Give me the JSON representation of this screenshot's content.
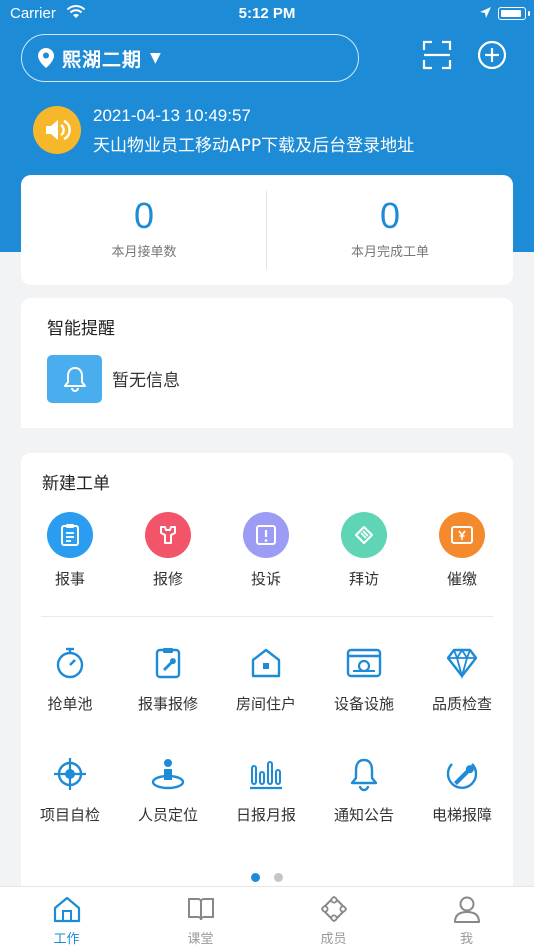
{
  "status_bar": {
    "carrier": "Carrier",
    "time": "5:12 PM"
  },
  "header": {
    "project_name": "熙湖二期",
    "arrow": "▼"
  },
  "notice": {
    "time": "2021-04-13 10:49:57",
    "text": "天山物业员工移动APP下载及后台登录地址"
  },
  "stats": [
    {
      "value": "0",
      "label": "本月接单数"
    },
    {
      "value": "0",
      "label": "本月完成工单"
    }
  ],
  "reminder": {
    "title": "智能提醒",
    "empty_text": "暂无信息"
  },
  "new_order": {
    "title": "新建工单",
    "primary": [
      {
        "label": "报事",
        "icon": "clipboard-icon",
        "color": "#2b9df0"
      },
      {
        "label": "报修",
        "icon": "wrench-icon",
        "color": "#f2546a"
      },
      {
        "label": "投诉",
        "icon": "complaint-icon",
        "color": "#9d9cf5"
      },
      {
        "label": "拜访",
        "icon": "visit-icon",
        "color": "#5fd5b6"
      },
      {
        "label": "催缴",
        "icon": "payment-icon",
        "color": "#f58a2d"
      }
    ],
    "functions": [
      {
        "label": "抢单池",
        "icon": "timer-icon"
      },
      {
        "label": "报事报修",
        "icon": "repair-report-icon"
      },
      {
        "label": "房间住户",
        "icon": "house-icon"
      },
      {
        "label": "设备设施",
        "icon": "equipment-icon"
      },
      {
        "label": "品质检查",
        "icon": "diamond-icon"
      },
      {
        "label": "项目自检",
        "icon": "crosshair-icon"
      },
      {
        "label": "人员定位",
        "icon": "person-location-icon"
      },
      {
        "label": "日报月报",
        "icon": "bar-report-icon"
      },
      {
        "label": "通知公告",
        "icon": "bell-icon"
      },
      {
        "label": "电梯报障",
        "icon": "elevator-fault-icon"
      }
    ]
  },
  "tabs": [
    {
      "label": "工作",
      "icon": "home-icon",
      "active": true
    },
    {
      "label": "课堂",
      "icon": "book-icon",
      "active": false
    },
    {
      "label": "成员",
      "icon": "members-icon",
      "active": false
    },
    {
      "label": "我",
      "icon": "profile-icon",
      "active": false
    }
  ],
  "colors": {
    "primary": "#1d8bd6",
    "notice_icon": "#f6b82a",
    "reminder_icon": "#4aaeee"
  }
}
